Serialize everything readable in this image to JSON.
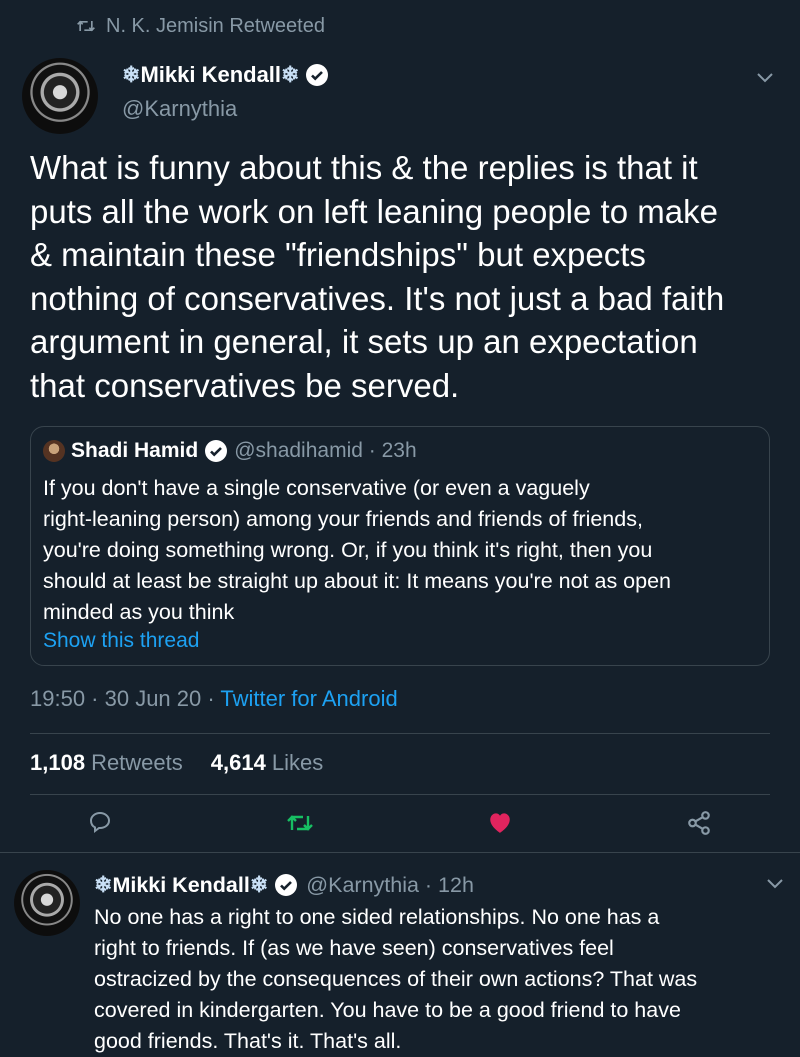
{
  "retweet_banner": {
    "text": "N. K. Jemisin Retweeted"
  },
  "tweet": {
    "author_name": "Mikki Kendall",
    "author_handle": "@Karnythia",
    "text": "What is funny about this & the replies is that it\nputs all the work on left leaning people to make\n& maintain these \"friendships\" but expects\nnothing of conservatives. It's not just a bad faith\nargument in general,  it sets up an expectation\nthat conservatives be served.",
    "timestamp": "19:50 · 30 Jun 20 · ",
    "source": "Twitter for Android",
    "retweets_count": "1,108",
    "retweets_label": "Retweets",
    "likes_count": "4,614",
    "likes_label": "Likes"
  },
  "quoted_tweet": {
    "author_name": "Shadi Hamid",
    "meta": "@shadihamid · 23h",
    "text": "If you don't have a single conservative (or even a vaguely\nright-leaning person) among your friends and friends of friends,\nyou're doing something wrong. Or, if you think it's right, then you\nshould at least be straight up about it: It means you're not as open\nminded as you think",
    "show_thread": "Show this thread"
  },
  "actions": {
    "reply_icon": "speech-bubble",
    "retweet_icon": "retweet-arrows",
    "retweet_color": "#17bf63",
    "like_icon": "heart-filled",
    "like_color": "#e0245e",
    "share_icon": "share-nodes"
  },
  "reply_tweet": {
    "author_name": "Mikki Kendall",
    "meta": "@Karnythia · 12h",
    "text": "No one has a right to one sided relationships. No one has a\nright to friends. If (as we have seen) conservatives feel\nostracized by the consequences of their own actions? That was\ncovered in kindergarten. You have to be a good friend to have\ngood friends. That's it. That's all."
  },
  "colors": {
    "background": "#15202b",
    "muted": "#8899a6",
    "accent": "#1da1f2",
    "divider": "#38444d"
  }
}
